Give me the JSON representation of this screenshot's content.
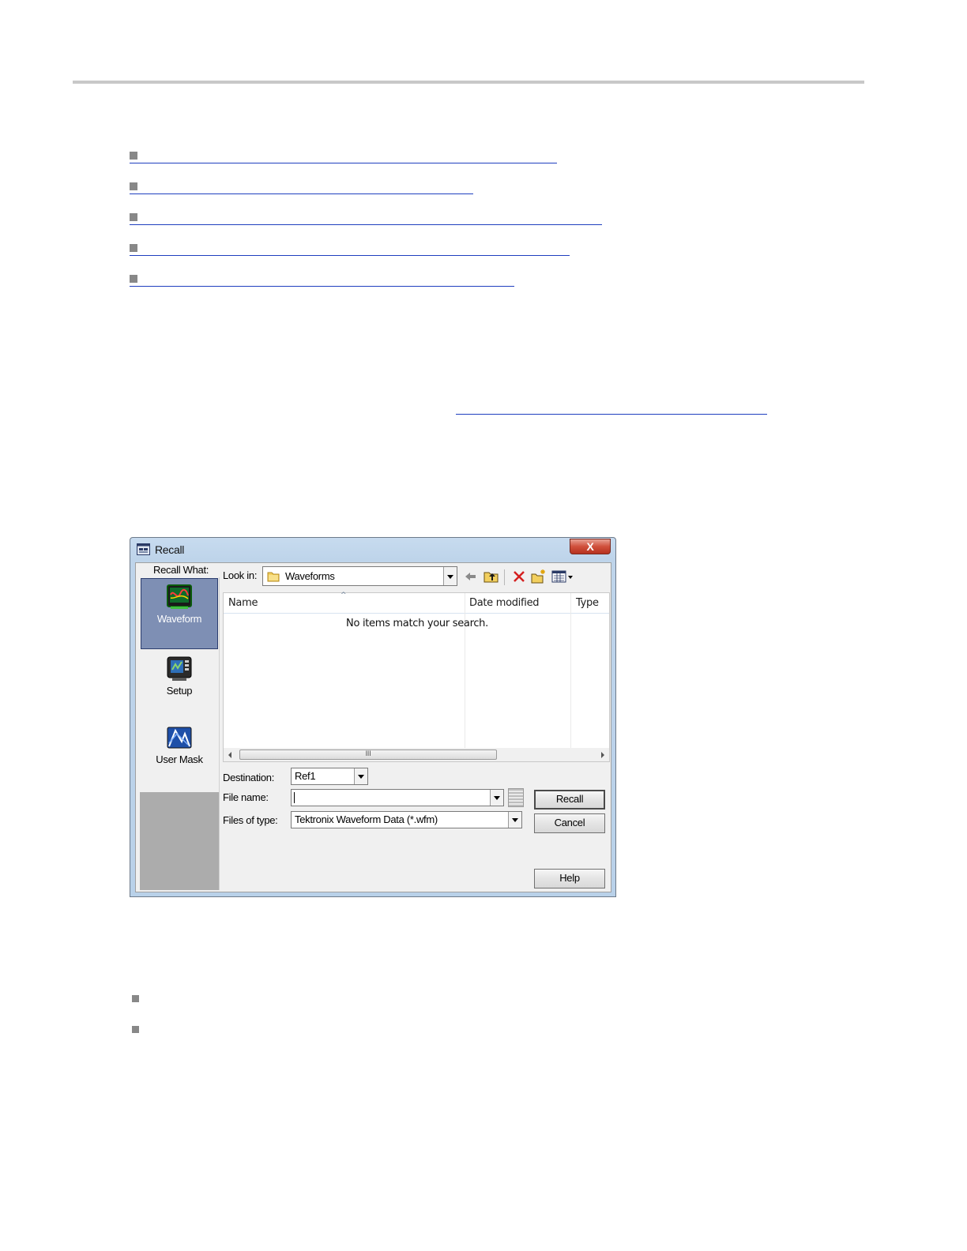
{
  "dialog": {
    "title": "Recall",
    "close_glyph": "X",
    "recall_what_label": "Recall What:",
    "left_items": [
      {
        "label": "Waveform",
        "icon": "waveform-icon",
        "selected": true
      },
      {
        "label": "Setup",
        "icon": "setup-icon",
        "selected": false
      },
      {
        "label": "User Mask",
        "icon": "user-mask-icon",
        "selected": false
      }
    ],
    "look_in": {
      "label": "Look in:",
      "value": "Waveforms"
    },
    "toolbar_icons": [
      "back-arrow-icon",
      "up-folder-icon",
      "delete-icon",
      "new-folder-icon",
      "view-menu-icon"
    ],
    "columns": [
      "Name",
      "Date modified",
      "Type"
    ],
    "empty_message": "No items match your search.",
    "scroll_thumb_glyph": "III",
    "destination": {
      "label": "Destination:",
      "value": "Ref1"
    },
    "file_name": {
      "label": "File name:",
      "value": ""
    },
    "files_of_type": {
      "label": "Files of type:",
      "value": "Tektronix Waveform Data (*.wfm)"
    },
    "buttons": {
      "recall": "Recall",
      "cancel": "Cancel",
      "help": "Help"
    }
  },
  "colors": {
    "link_underline": "#1f3fbf",
    "selected_item": "#7e8fb4",
    "close_button": "#c84532"
  }
}
